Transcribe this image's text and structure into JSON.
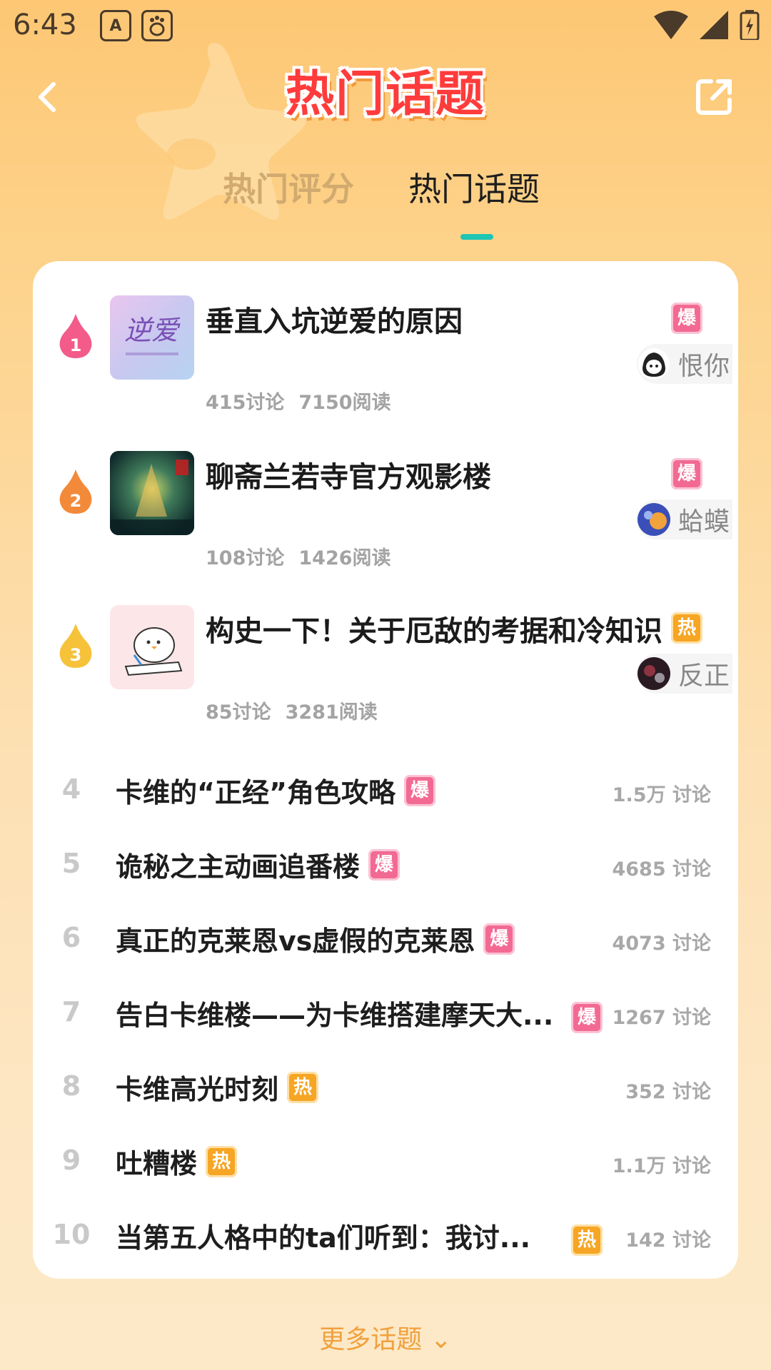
{
  "status": {
    "time": "6:43"
  },
  "header": {
    "title": "热门话题"
  },
  "tabs": [
    {
      "label": "热门评分",
      "active": false
    },
    {
      "label": "热门话题",
      "active": true
    }
  ],
  "top_topics": [
    {
      "rank": "1",
      "title": "垂直入坑逆爱的原因",
      "badge": "爆",
      "author": "恨你",
      "discussions": "415讨论",
      "reads": "7150阅读",
      "flame_color": "#f25b8a",
      "thumb_text": "逆爱"
    },
    {
      "rank": "2",
      "title": "聊斋兰若寺官方观影楼",
      "badge": "爆",
      "author": "蛤蟆",
      "discussions": "108讨论",
      "reads": "1426阅读",
      "flame_color": "#f38a3a"
    },
    {
      "rank": "3",
      "title": "构史一下！关于厄敌的考据和冷知识",
      "badge": "热",
      "author": "反正",
      "discussions": "85讨论",
      "reads": "3281阅读",
      "flame_color": "#f6c23a"
    }
  ],
  "list_topics": [
    {
      "rank": "4",
      "title": "卡维的“正经”角色攻略",
      "badge": "爆",
      "count": "1.5万 讨论"
    },
    {
      "rank": "5",
      "title": "诡秘之主动画追番楼",
      "badge": "爆",
      "count": "4685 讨论"
    },
    {
      "rank": "6",
      "title": "真正的克莱恩vs虚假的克莱恩",
      "badge": "爆",
      "count": "4073 讨论"
    },
    {
      "rank": "7",
      "title": "告白卡维楼——为卡维搭建摩天大...",
      "badge": "爆",
      "count": "1267 讨论"
    },
    {
      "rank": "8",
      "title": "卡维高光时刻",
      "badge": "热",
      "count": "352 讨论"
    },
    {
      "rank": "9",
      "title": "吐糟楼",
      "badge": "热",
      "count": "1.1万 讨论"
    },
    {
      "rank": "10",
      "title": "当第五人格中的ta们听到：我讨...",
      "badge": "热",
      "count": "142 讨论"
    }
  ],
  "more": {
    "label": "更多话题 ⌄"
  }
}
